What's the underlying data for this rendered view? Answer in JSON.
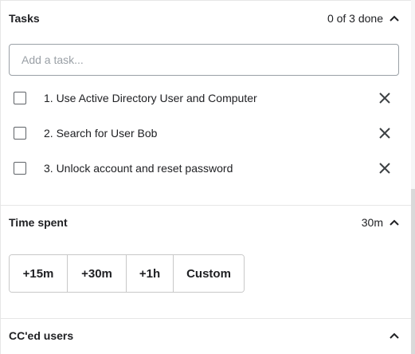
{
  "tasks_section": {
    "title": "Tasks",
    "progress": "0 of 3 done",
    "input_placeholder": "Add a task...",
    "items": [
      {
        "label": "1. Use Active Directory User and Computer",
        "done": false
      },
      {
        "label": "2. Search for User Bob",
        "done": false
      },
      {
        "label": "3. Unlock account and reset password",
        "done": false
      }
    ]
  },
  "time_section": {
    "title": "Time spent",
    "value": "30m",
    "options": [
      "+15m",
      "+30m",
      "+1h",
      "Custom"
    ]
  },
  "cc_section": {
    "title": "CC'ed users"
  },
  "icons": {
    "collapse": "chevron-up-icon",
    "remove": "close-icon"
  },
  "colors": {
    "text": "#202124",
    "border": "#9aa0a6",
    "divider": "#e6e6e6"
  }
}
